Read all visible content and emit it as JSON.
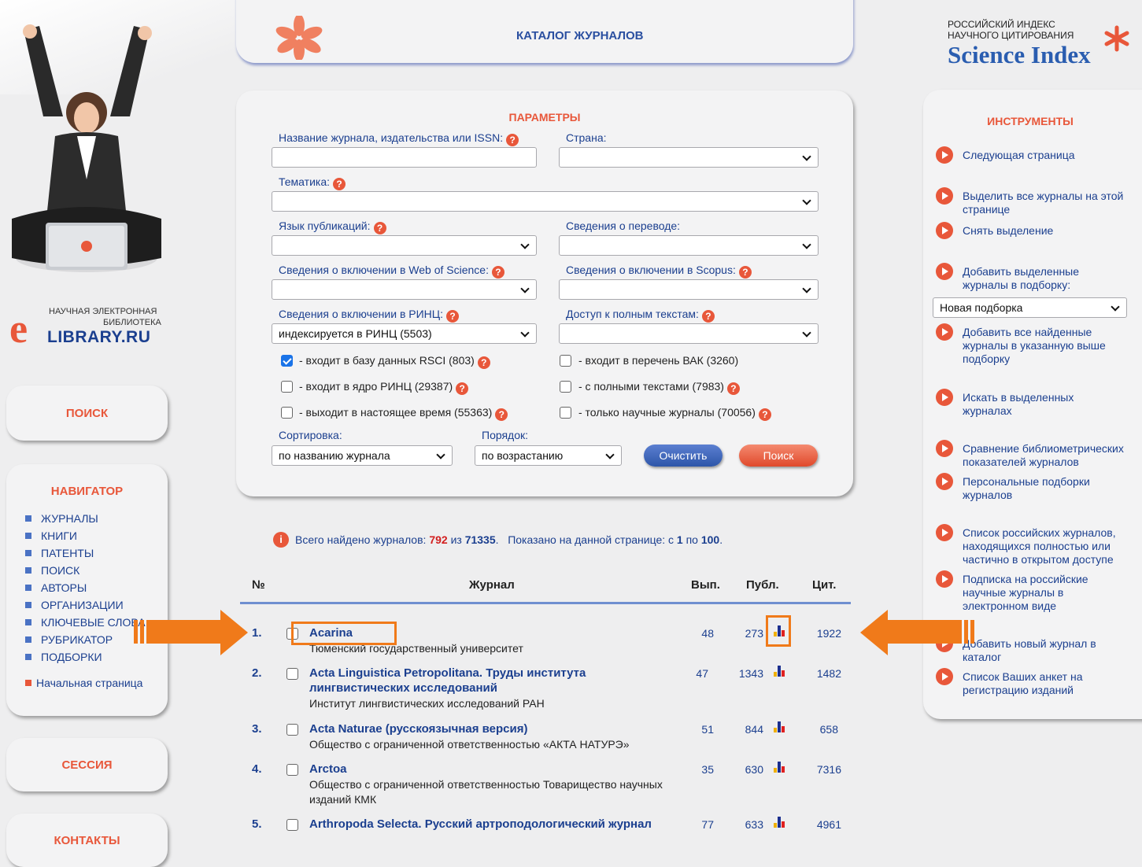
{
  "header": {
    "title": "КАТАЛОГ ЖУРНАЛОВ"
  },
  "logo_elibrary": {
    "line1": "НАУЧНАЯ ЭЛЕКТРОННАЯ",
    "line2": "БИБЛИОТЕКА",
    "brand": "LIBRARY.RU"
  },
  "logo_science_index": {
    "line1": "РОССИЙСКИЙ ИНДЕКС",
    "line2": "НАУЧНОГО ЦИТИРОВАНИЯ",
    "brand": "Science Index"
  },
  "left": {
    "search_label": "ПОИСК",
    "navigator_title": "НАВИГАТОР",
    "nav_items": [
      "ЖУРНАЛЫ",
      "КНИГИ",
      "ПАТЕНТЫ",
      "ПОИСК",
      "АВТОРЫ",
      "ОРГАНИЗАЦИИ",
      "КЛЮЧЕВЫЕ СЛОВА",
      "РУБРИКАТОР",
      "ПОДБОРКИ"
    ],
    "home_link": "Начальная страница",
    "session_label": "СЕССИЯ",
    "contacts_label": "КОНТАКТЫ"
  },
  "params": {
    "title": "ПАРАМЕТРЫ",
    "journal_label": "Название журнала, издательства или ISSN:",
    "journal_value": "",
    "country_label": "Страна:",
    "country_value": "",
    "topic_label": "Тематика:",
    "topic_value": "",
    "lang_label": "Язык публикаций:",
    "lang_value": "",
    "translation_label": "Сведения о переводе:",
    "translation_value": "",
    "wos_label": "Сведения о включении в Web of Science:",
    "wos_value": "",
    "scopus_label": "Сведения о включении в Scopus:",
    "scopus_value": "",
    "rinc_label": "Сведения о включении в РИНЦ:",
    "rinc_value": "индексируется в РИНЦ  (5503)",
    "fulltext_label": "Доступ к полным текстам:",
    "fulltext_value": "",
    "checks": [
      {
        "label": "- входит в базу данных RSCI (803)",
        "checked": true
      },
      {
        "label": "- входит в перечень ВАК (3260)",
        "checked": false
      },
      {
        "label": "- входит в ядро РИНЦ (29387)",
        "checked": false
      },
      {
        "label": "- с полными текстами (7983)",
        "checked": false
      },
      {
        "label": "- выходит в настоящее время (55363)",
        "checked": false
      },
      {
        "label": "- только научные журналы (70056)",
        "checked": false
      }
    ],
    "sort_label": "Сортировка:",
    "sort_value": "по названию журнала",
    "order_label": "Порядок:",
    "order_value": "по возрастанию",
    "clear_button": "Очистить",
    "search_button": "Поиск"
  },
  "summary": {
    "found_prefix": "Всего найдено журналов:",
    "found": "792",
    "of_word": "из",
    "total": "71335",
    "shown_prefix": "Показано на данной странице: с",
    "from": "1",
    "to_word": "по",
    "to": "100"
  },
  "table": {
    "headers": {
      "num": "№",
      "journal": "Журнал",
      "issues": "Вып.",
      "pubs": "Публ.",
      "cites": "Цит."
    },
    "rows": [
      {
        "num": "1.",
        "title": "Acarina",
        "publisher": "Тюменский государственный университет",
        "issues": "48",
        "pubs": "273",
        "cites": "1922"
      },
      {
        "num": "2.",
        "title": "Acta Linguistica Petropolitana. Труды института лингвистических исследований",
        "publisher": "Институт лингвистических исследований РАН",
        "issues": "47",
        "pubs": "1343",
        "cites": "1482"
      },
      {
        "num": "3.",
        "title": "Acta Naturae (русскоязычная версия)",
        "publisher": "Общество с ограниченной ответственностью «АКТА НАТУРЭ»",
        "issues": "51",
        "pubs": "844",
        "cites": "658"
      },
      {
        "num": "4.",
        "title": "Arctoa",
        "publisher": "Общество с ограниченной ответственностью Товарищество научных изданий КМК",
        "issues": "35",
        "pubs": "630",
        "cites": "7316"
      },
      {
        "num": "5.",
        "title": "Arthropoda Selecta. Русский артроподологический журнал",
        "publisher": "",
        "issues": "77",
        "pubs": "633",
        "cites": "4961"
      }
    ]
  },
  "tools": {
    "title": "ИНСТРУМЕНТЫ",
    "items": [
      "Следующая страница",
      "Выделить все журналы на этой странице",
      "Снять выделение",
      "Добавить выделенные журналы в подборку:",
      "Добавить все найденные журналы в указанную выше подборку",
      "Искать в выделенных журналах",
      "Сравнение библиометрических показателей журналов",
      "Персональные подборки журналов",
      "Список российских журналов, находящихся полностью или частично в открытом доступе",
      "Подписка на российские научные журналы в электронном виде",
      "Добавить новый журнал в каталог",
      "Список Ваших анкет на регистрацию изданий"
    ],
    "collection_select": "Новая подборка"
  },
  "colors": {
    "accent": "#e8573a",
    "link": "#1b3f8f",
    "highlight": "#f07a1a"
  }
}
